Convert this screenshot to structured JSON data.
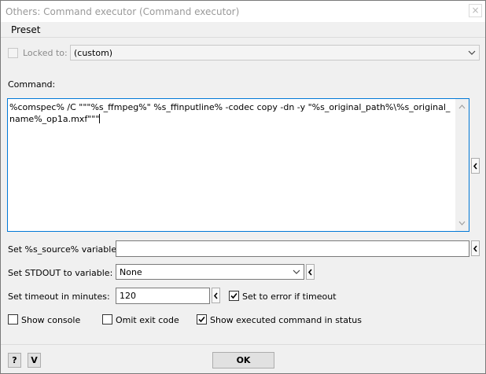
{
  "window": {
    "title": "Others: Command executor (Command executor)",
    "close_glyph": "×"
  },
  "menu": {
    "preset": "Preset"
  },
  "locked": {
    "label": "Locked to:",
    "value": "(custom)"
  },
  "command": {
    "label": "Command:",
    "value": "%comspec% /C \"\"\"%s_ffmpeg%\" %s_ffinputline% -codec copy -dn -y \"%s_original_path%\\%s_original_name%_op1a.mxf\"\"\""
  },
  "source_var": {
    "label": "Set %s_source% variable to:",
    "value": ""
  },
  "stdout_var": {
    "label": "Set STDOUT to variable:",
    "value": "None"
  },
  "timeout": {
    "label": "Set timeout in minutes:",
    "value": "120",
    "error_label": "Set to error if timeout",
    "error_checked": true
  },
  "options": {
    "show_console": {
      "label": "Show console",
      "checked": false
    },
    "omit_exit_code": {
      "label": "Omit exit code",
      "checked": false
    },
    "show_executed": {
      "label": "Show executed command in status",
      "checked": true
    }
  },
  "footer": {
    "help": "?",
    "v": "V",
    "ok": "OK"
  }
}
